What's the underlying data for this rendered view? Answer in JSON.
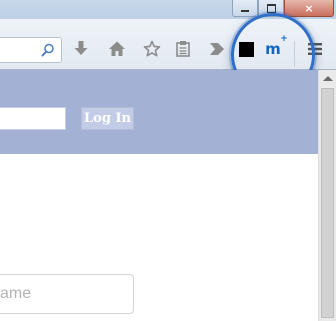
{
  "window": {
    "minimize_glyph": "",
    "restore_glyph": "",
    "close_glyph": "×"
  },
  "toolbar": {
    "icons": [
      "search-icon",
      "download-icon",
      "home-icon",
      "bookmark-star-icon",
      "reading-list-icon",
      "overflow-chevron-icon",
      "extension-black-square-icon",
      "mplus-extension-icon",
      "menu-hamburger-icon"
    ],
    "mplus_label": "m",
    "mplus_superscript": "+"
  },
  "page": {
    "login_button": "Log In",
    "name_placeholder": "ame"
  },
  "colors": {
    "banner": "#a3b1d4",
    "login_button": "#c3cce6",
    "magnifier_ring": "#2f6fc7",
    "mplus": "#1565c0"
  }
}
